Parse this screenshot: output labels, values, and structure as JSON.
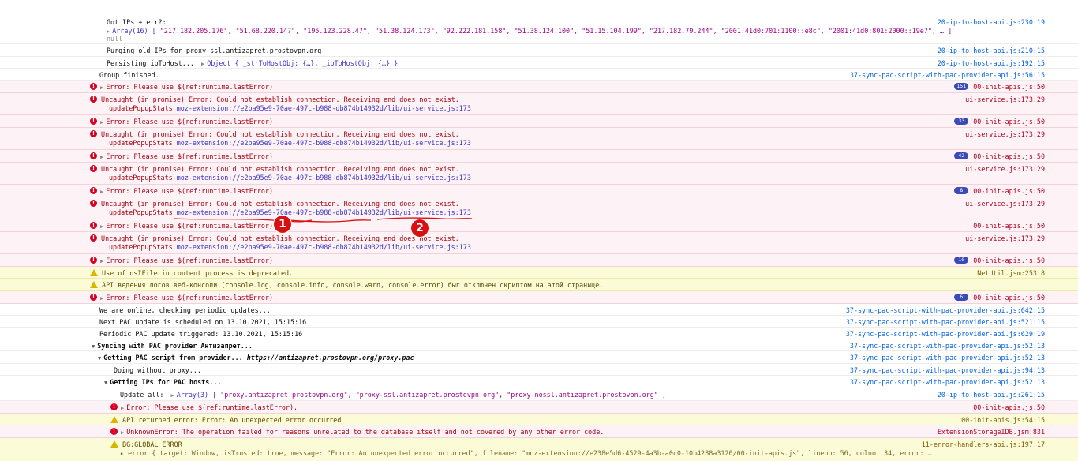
{
  "rows": {
    "r0": {
      "line1": "Got IPs + err?:",
      "arr_label": "Array(16) [",
      "arr_items": "\"217.182.205.176\", \"51.68.220.147\", \"195.123.228.47\", \"51.38.124.173\", \"92.222.181.158\", \"51.38.124.100\", \"51.15.104.199\", \"217.182.79.244\", \"2001:41d0:701:1100::e8c\", \"2001:41d0:801:2000::19e7\", … ]",
      "line3": "null",
      "src": "20-ip-to-host-api.js:230:19"
    },
    "r1": {
      "text": "Purging old IPs for proxy-ssl.antizapret.prostovpn.org",
      "src": "20-ip-to-host-api.js:210:15"
    },
    "r2": {
      "text": "Persisting ipToHost...",
      "obj": "Object { _strToHostObj: {…}, _ipToHostObj: {…} }",
      "src": "20-ip-to-host-api.js:192:15"
    },
    "r3": {
      "text": "Group finished.",
      "src": "37-sync-pac-script-with-pac-provider-api.js:56:15"
    },
    "r4": {
      "text": "Error: Please use $(ref:runtime.lastError).",
      "badge": "151",
      "src": "00-init-apis.js:50"
    },
    "r5": {
      "text": "Uncaught (in promise) Error: Could not establish connection. Receiving end does not exist.",
      "fn": "updatePopupStats",
      "link": "moz-extension://e2ba95e9-70ae-497c-b988-db874b14932d/lib/ui-service.js:173",
      "src": "ui-service.js:173:29"
    },
    "r6": {
      "text": "Error: Please use $(ref:runtime.lastError).",
      "badge": "33",
      "src": "00-init-apis.js:50"
    },
    "r7": {
      "text": "Uncaught (in promise) Error: Could not establish connection. Receiving end does not exist.",
      "fn": "updatePopupStats",
      "link": "moz-extension://e2ba95e9-70ae-497c-b988-db874b14932d/lib/ui-service.js:173",
      "src": "ui-service.js:173:29"
    },
    "r8": {
      "text": "Error: Please use $(ref:runtime.lastError).",
      "badge": "42",
      "src": "00-init-apis.js:50"
    },
    "r9": {
      "text": "Uncaught (in promise) Error: Could not establish connection. Receiving end does not exist.",
      "fn": "updatePopupStats",
      "link": "moz-extension://e2ba95e9-70ae-497c-b988-db874b14932d/lib/ui-service.js:173",
      "src": "ui-service.js:173:29"
    },
    "r10": {
      "text": "Error: Please use $(ref:runtime.lastError).",
      "badge": "8",
      "src": "00-init-apis.js:50"
    },
    "r11": {
      "text": "Uncaught (in promise) Error: Could not establish connection. Receiving end does not exist.",
      "fn": "updatePopupStats",
      "link": "moz-extension://e2ba95e9-70ae-497c-b988-db874b14932d/lib/ui-service.js:173",
      "src": "ui-service.js:173:29"
    },
    "r12": {
      "text": "Error: Please use $(ref:runtime.lastError).",
      "src": "00-init-apis.js:50"
    },
    "r13": {
      "text": "Uncaught (in promise) Error: Could not establish connection. Receiving end does not exist.",
      "fn": "updatePopupStats",
      "link": "moz-extension://e2ba95e9-70ae-497c-b988-db874b14932d/lib/ui-service.js:173",
      "src": "ui-service.js:173:29"
    },
    "r14": {
      "text": "Error: Please use $(ref:runtime.lastError).",
      "badge": "10",
      "src": "00-init-apis.js:50"
    },
    "r15": {
      "text": "Use of nsIFile in content process is deprecated.",
      "src": "NetUtil.jsm:253:8"
    },
    "r16": {
      "text": "API ведения логов веб-консоли (console.log, console.info, console.warn, console.error) был отключен скриптом на этой странице.",
      "src": ""
    },
    "r17": {
      "text": "Error: Please use $(ref:runtime.lastError).",
      "badge": "6",
      "src": "00-init-apis.js:50"
    },
    "r18": {
      "text": "We are online, checking periodic updates...",
      "src": "37-sync-pac-script-with-pac-provider-api.js:642:15"
    },
    "r19": {
      "text": "Next PAC update is scheduled on 13.10.2021, 15:15:16",
      "src": "37-sync-pac-script-with-pac-provider-api.js:521:15"
    },
    "r20": {
      "text": "Periodic PAC update triggered: 13.10.2021, 15:15:16",
      "src": "37-sync-pac-script-with-pac-provider-api.js:629:19"
    },
    "r21": {
      "text": "Syncing with PAC provider Антизапрет...",
      "src": "37-sync-pac-script-with-pac-provider-api.js:52:13"
    },
    "r22": {
      "text": "Getting PAC script from provider...",
      "url": "https://antizapret.prostovpn.org/proxy.pac",
      "src": "37-sync-pac-script-with-pac-provider-api.js:52:13"
    },
    "r23": {
      "text": "Doing without proxy...",
      "src": "37-sync-pac-script-with-pac-provider-api.js:94:13"
    },
    "r24": {
      "text": "Getting IPs for PAC hosts...",
      "src": "37-sync-pac-script-with-pac-provider-api.js:52:13"
    },
    "r25": {
      "text": "Update all:",
      "arr_label": "Array(3) [",
      "arr_items": "\"proxy.antizapret.prostovpn.org\", \"proxy-ssl.antizapret.prostovpn.org\", \"proxy-nossl.antizapret.prostovpn.org\" ]",
      "src": "20-ip-to-host-api.js:261:15"
    },
    "r26": {
      "text": "Error: Please use $(ref:runtime.lastError).",
      "src": "00-init-apis.js:50"
    },
    "r27": {
      "text": "API returned error: Error: An unexpected error occurred",
      "src": "00-init-apis.js:54:15"
    },
    "r28": {
      "text": "UnknownError: The operation failed for reasons unrelated to the database itself and not covered by any other error code.",
      "src": "ExtensionStorageIDB.jsm:831"
    },
    "r29": {
      "text": "BG:GLOBAL ERROR",
      "text2": "▸ error { target: Window, isTrusted: true, message: \"Error: An unexpected error occurred\", filename: \"moz-extension://e238e5d6-4529-4a3b-a0c0-10b4288a3120/00-init-apis.js\", lineno: 56, colno: 34, error: …",
      "src": "11-error-handlers-api.js:197:17"
    }
  },
  "annotations": {
    "marker1": "1",
    "marker2": "2",
    "stroke_color": "#d91010"
  },
  "colors": {
    "error_bg": "#fdf2f5",
    "warn_bg": "#fbfbd8",
    "link": "#3b33c5",
    "string": "#a0008b",
    "group_line": "#6b6bd6"
  }
}
